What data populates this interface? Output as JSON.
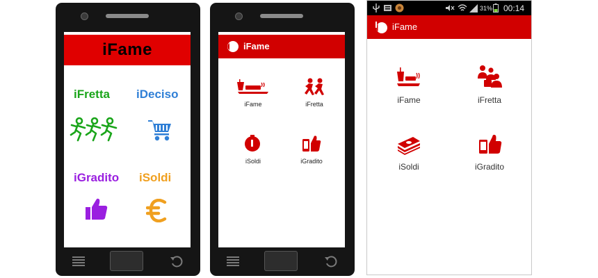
{
  "colors": {
    "brand_red": "#d10000",
    "green": "#1aa51a",
    "blue": "#2f7fd6",
    "purple": "#9a1fe0",
    "orange": "#f0a020"
  },
  "phone1": {
    "title": "iFame",
    "items": [
      {
        "label": "iFretta",
        "icon": "running-people-icon"
      },
      {
        "label": "iDeciso",
        "icon": "shopping-cart-icon"
      },
      {
        "label": "iGradito",
        "icon": "thumbs-up-icon"
      },
      {
        "label": "iSoldi",
        "icon": "euro-icon"
      }
    ]
  },
  "phone2": {
    "title": "iFame",
    "tiles": [
      {
        "label": "iFame",
        "icon": "food-tray-icon"
      },
      {
        "label": "iFretta",
        "icon": "running-people-icon"
      },
      {
        "label": "iSoldi",
        "icon": "piggy-bank-icon"
      },
      {
        "label": "iGradito",
        "icon": "phone-thumbs-up-icon"
      }
    ]
  },
  "app3": {
    "status": {
      "battery": "31%",
      "time": "00:14"
    },
    "title": "iFame",
    "tiles": [
      {
        "label": "iFame",
        "icon": "food-tray-icon"
      },
      {
        "label": "iFretta",
        "icon": "people-group-icon"
      },
      {
        "label": "iSoldi",
        "icon": "money-stack-icon"
      },
      {
        "label": "iGradito",
        "icon": "phone-thumbs-up-icon"
      }
    ]
  }
}
